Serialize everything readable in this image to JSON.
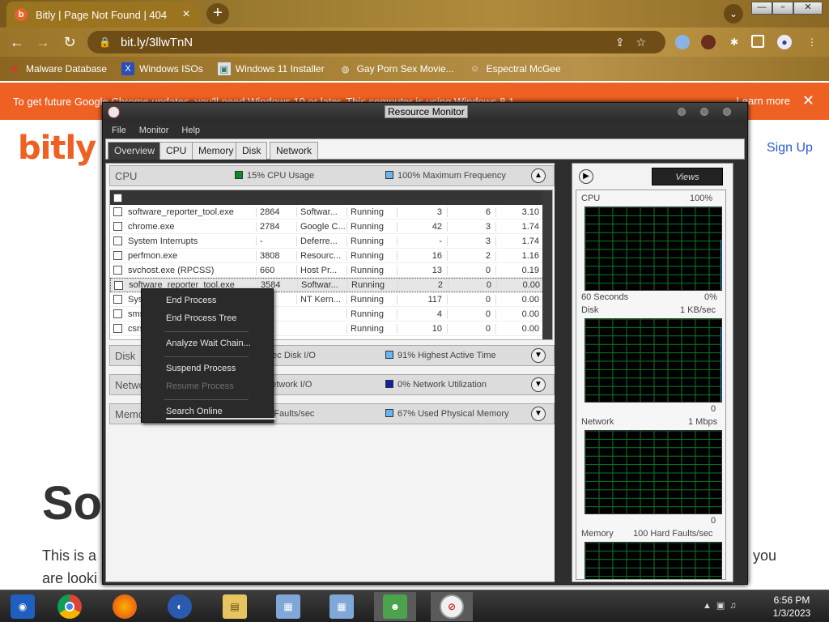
{
  "browser": {
    "tab_title": "Bitly | Page Not Found | 404",
    "tab_favicon": "b",
    "new_tab": "+",
    "tab_search": "⌄",
    "win_min": "—",
    "win_max": "▫",
    "win_close": "✕",
    "url": "bit.ly/3llwTnN",
    "bookmarks": [
      {
        "label": "Malware Database",
        "icon": "malware-icon"
      },
      {
        "label": "Windows ISOs",
        "icon": "x-icon"
      },
      {
        "label": "Windows 11 Installer",
        "icon": "image-icon"
      },
      {
        "label": "Gay Porn Sex Movie...",
        "icon": "globe-icon"
      },
      {
        "label": "Espectral McGee",
        "icon": "avatar-icon"
      }
    ]
  },
  "banner": {
    "text": "To get future Google Chrome updates, you'll need Windows 10 or later. This computer is using Windows 8.1.",
    "learn_more": "Learn more",
    "close": "✕"
  },
  "page": {
    "logo": "bitly",
    "sign_up": "Sign Up",
    "big_heading": "So",
    "body_line1": "This is a",
    "body_line2": "are looki",
    "body_right": "you"
  },
  "resmon": {
    "title": "Resource Monitor",
    "menu": [
      "File",
      "Monitor",
      "Help"
    ],
    "tabs": [
      "Overview",
      "CPU",
      "Memory",
      "Disk",
      "Network"
    ],
    "cpu": {
      "name": "CPU",
      "usage": "15% CPU Usage",
      "freq": "100% Maximum Frequency",
      "usage_color": "#0a8a2a",
      "freq_color": "#6ab4f0",
      "rows": [
        [
          "software_reporter_tool.exe",
          "2864",
          "Softwar...",
          "Running",
          "3",
          "6",
          "3.10"
        ],
        [
          "chrome.exe",
          "2784",
          "Google C...",
          "Running",
          "42",
          "3",
          "1.74"
        ],
        [
          "System Interrupts",
          "-",
          "Deferre...",
          "Running",
          "-",
          "3",
          "1.74"
        ],
        [
          "perfmon.exe",
          "3808",
          "Resourc...",
          "Running",
          "16",
          "2",
          "1.16"
        ],
        [
          "svchost.exe (RPCSS)",
          "660",
          "Host Pr...",
          "Running",
          "13",
          "0",
          "0.19"
        ],
        [
          "software_reporter_tool.exe",
          "3584",
          "Softwar...",
          "Running",
          "2",
          "0",
          "0.00"
        ],
        [
          "System",
          "4",
          "NT Kern...",
          "Running",
          "117",
          "0",
          "0.00"
        ],
        [
          "smss.exe",
          "",
          "",
          "Running",
          "4",
          "0",
          "0.00"
        ],
        [
          "csrss.exe",
          "",
          "",
          "Running",
          "10",
          "0",
          "0.00"
        ]
      ]
    },
    "disk": {
      "name": "Disk",
      "io": "36 B/sec Disk I/O",
      "active": "91% Highest Active Time",
      "io_color": "#0a8a2a",
      "active_color": "#6ab4f0"
    },
    "network": {
      "name": "Network",
      "io": "0 Kbps Network I/O",
      "util": "0% Network Utilization",
      "util_color": "#1020a0"
    },
    "memory": {
      "name": "Memory",
      "faults": "100 Hard Faults/sec",
      "used": "67% Used Physical Memory",
      "used_color": "#6ab4f0"
    },
    "context_menu": {
      "end_process": "End Process",
      "end_tree": "End Process Tree",
      "wait_chain": "Analyze Wait Chain...",
      "suspend": "Suspend Process",
      "resume": "Resume Process",
      "search": "Search Online"
    },
    "right": {
      "views": "Views",
      "cpu_label": "CPU",
      "cpu_max": "100%",
      "cpu_time": "60 Seconds",
      "cpu_min": "0%",
      "disk_label": "Disk",
      "disk_max": "1 KB/sec",
      "disk_min": "0",
      "net_label": "Network",
      "net_max": "1 Mbps",
      "net_min": "0",
      "mem_label": "Memory",
      "mem_max": "100 Hard Faults/sec"
    }
  },
  "taskbar": {
    "apps": [
      "chromium-icon",
      "chrome-icon",
      "firefox-icon",
      "obama-icon",
      "file-explorer-icon",
      "installer-icon",
      "installer-icon-2",
      "people-icon",
      "resource-monitor-icon"
    ],
    "time": "6:56 PM",
    "date": "1/3/2023"
  }
}
